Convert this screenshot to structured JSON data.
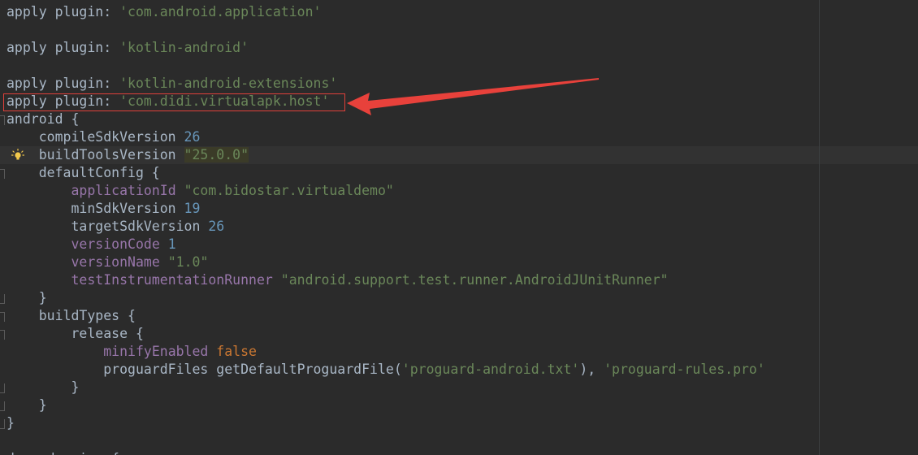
{
  "editor": {
    "lines": [
      {
        "k": "line-1",
        "parts": [
          {
            "t": "apply ",
            "c": "plain"
          },
          {
            "t": "plugin",
            "c": "plain"
          },
          {
            "t": ": ",
            "c": "plain"
          },
          {
            "t": "'com.android.application'",
            "c": "str-single"
          }
        ]
      },
      {
        "k": "line-2",
        "parts": []
      },
      {
        "k": "line-3",
        "parts": [
          {
            "t": "apply ",
            "c": "plain"
          },
          {
            "t": "plugin",
            "c": "plain"
          },
          {
            "t": ": ",
            "c": "plain"
          },
          {
            "t": "'kotlin-android'",
            "c": "str-single"
          }
        ]
      },
      {
        "k": "line-4",
        "parts": []
      },
      {
        "k": "line-5",
        "parts": [
          {
            "t": "apply ",
            "c": "plain"
          },
          {
            "t": "plugin",
            "c": "plain"
          },
          {
            "t": ": ",
            "c": "plain"
          },
          {
            "t": "'kotlin-android-extensions'",
            "c": "str-single"
          }
        ]
      },
      {
        "k": "line-6",
        "parts": [
          {
            "t": "apply ",
            "c": "plain"
          },
          {
            "t": "plugin",
            "c": "plain"
          },
          {
            "t": ": ",
            "c": "plain"
          },
          {
            "t": "'com.didi.virtualapk.host'",
            "c": "str-single"
          }
        ]
      },
      {
        "k": "line-7",
        "parts": [
          {
            "t": "android {",
            "c": "plain"
          }
        ]
      },
      {
        "k": "line-8",
        "parts": [
          {
            "t": "    compileSdkVersion ",
            "c": "plain"
          },
          {
            "t": "26",
            "c": "num"
          }
        ]
      },
      {
        "k": "line-9",
        "parts": [
          {
            "t": "    buildToolsVersion ",
            "c": "plain"
          },
          {
            "t": "\"25.0.0\"",
            "c": "highlight-str"
          }
        ]
      },
      {
        "k": "line-10",
        "parts": [
          {
            "t": "    defaultConfig {",
            "c": "plain"
          }
        ]
      },
      {
        "k": "line-11",
        "parts": [
          {
            "t": "        ",
            "c": "plain"
          },
          {
            "t": "applicationId",
            "c": "prop"
          },
          {
            "t": " ",
            "c": "plain"
          },
          {
            "t": "\"com.bidostar.virtualdemo\"",
            "c": "str-double"
          }
        ]
      },
      {
        "k": "line-12",
        "parts": [
          {
            "t": "        minSdkVersion ",
            "c": "plain"
          },
          {
            "t": "19",
            "c": "num"
          }
        ]
      },
      {
        "k": "line-13",
        "parts": [
          {
            "t": "        targetSdkVersion ",
            "c": "plain"
          },
          {
            "t": "26",
            "c": "num"
          }
        ]
      },
      {
        "k": "line-14",
        "parts": [
          {
            "t": "        ",
            "c": "plain"
          },
          {
            "t": "versionCode",
            "c": "prop"
          },
          {
            "t": " ",
            "c": "plain"
          },
          {
            "t": "1",
            "c": "num"
          }
        ]
      },
      {
        "k": "line-15",
        "parts": [
          {
            "t": "        ",
            "c": "plain"
          },
          {
            "t": "versionName",
            "c": "prop"
          },
          {
            "t": " ",
            "c": "plain"
          },
          {
            "t": "\"1.0\"",
            "c": "str-double"
          }
        ]
      },
      {
        "k": "line-16",
        "parts": [
          {
            "t": "        ",
            "c": "plain"
          },
          {
            "t": "testInstrumentationRunner",
            "c": "prop"
          },
          {
            "t": " ",
            "c": "plain"
          },
          {
            "t": "\"android.support.test.runner.AndroidJUnitRunner\"",
            "c": "str-double"
          }
        ]
      },
      {
        "k": "line-17",
        "parts": [
          {
            "t": "    }",
            "c": "plain"
          }
        ]
      },
      {
        "k": "line-18",
        "parts": [
          {
            "t": "    buildTypes {",
            "c": "plain"
          }
        ]
      },
      {
        "k": "line-19",
        "parts": [
          {
            "t": "        release {",
            "c": "plain"
          }
        ]
      },
      {
        "k": "line-20",
        "parts": [
          {
            "t": "            ",
            "c": "plain"
          },
          {
            "t": "minifyEnabled",
            "c": "prop"
          },
          {
            "t": " ",
            "c": "plain"
          },
          {
            "t": "false",
            "c": "kw"
          }
        ]
      },
      {
        "k": "line-21",
        "parts": [
          {
            "t": "            proguardFiles getDefaultProguardFile(",
            "c": "plain"
          },
          {
            "t": "'proguard-android.txt'",
            "c": "str-single"
          },
          {
            "t": "), ",
            "c": "plain"
          },
          {
            "t": "'proguard-rules.pro'",
            "c": "str-single"
          }
        ]
      },
      {
        "k": "line-22",
        "parts": [
          {
            "t": "        }",
            "c": "plain"
          }
        ]
      },
      {
        "k": "line-23",
        "parts": [
          {
            "t": "    }",
            "c": "plain"
          }
        ]
      },
      {
        "k": "line-24",
        "parts": [
          {
            "t": "}",
            "c": "plain"
          }
        ]
      },
      {
        "k": "line-25",
        "parts": []
      },
      {
        "k": "line-26",
        "parts": [
          {
            "t": "dependencies {",
            "c": "plain"
          }
        ]
      }
    ]
  },
  "annotation": {
    "box_color": "#e0403a",
    "arrow_color": "#e8413b"
  },
  "icons": {
    "intention": "lightbulb-icon"
  }
}
